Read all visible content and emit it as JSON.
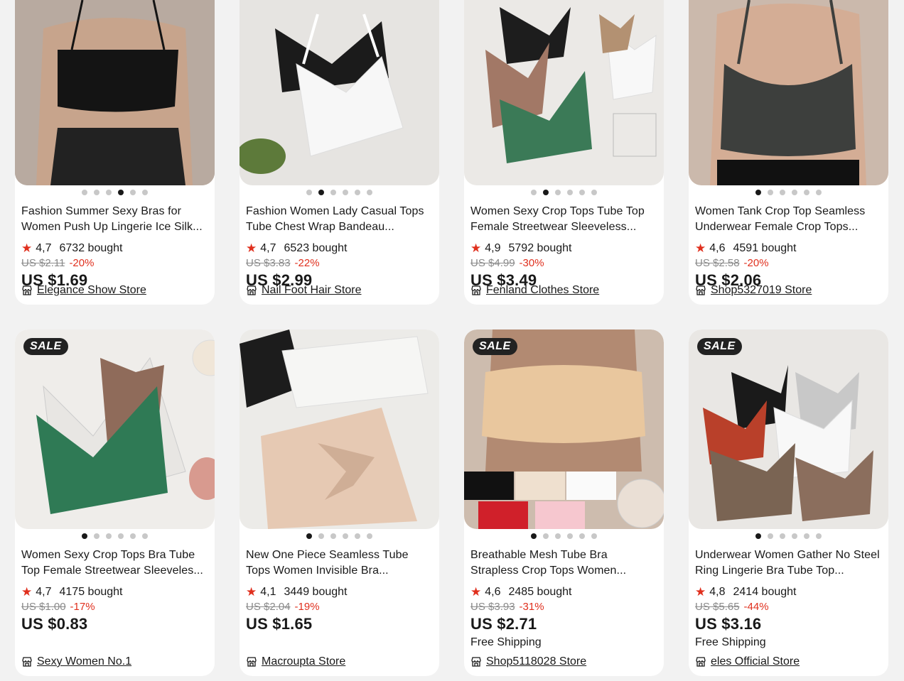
{
  "colors": {
    "accent_red": "#e0301e",
    "bg": "#f2f2f2",
    "card": "#ffffff"
  },
  "products": [
    {
      "title": "Fashion Summer Sexy Bras for Women Push Up Lingerie Ice Silk...",
      "rating": "4,7",
      "sold": "6732 bought",
      "original_price": "US $2.11",
      "discount": "-20%",
      "price": "US $1.69",
      "store": "Elegance Show Store",
      "sale_badge": "",
      "shipping": "",
      "active_dot": 3
    },
    {
      "title": "Fashion Women Lady Casual Tops Tube Chest Wrap Bandeau...",
      "rating": "4,7",
      "sold": "6523 bought",
      "original_price": "US $3.83",
      "discount": "-22%",
      "price": "US $2.99",
      "store": "Nail Foot Hair Store",
      "sale_badge": "",
      "shipping": "",
      "active_dot": 1
    },
    {
      "title": "Women Sexy Crop Tops Tube Top Female Streetwear Sleeveless...",
      "rating": "4,9",
      "sold": "5792 bought",
      "original_price": "US $4.99",
      "discount": "-30%",
      "price": "US $3.49",
      "store": "Fenland Clothes Store",
      "sale_badge": "",
      "shipping": "",
      "active_dot": 1
    },
    {
      "title": "Women Tank Crop Top Seamless Underwear Female Crop Tops...",
      "rating": "4,6",
      "sold": "4591 bought",
      "original_price": "US $2.58",
      "discount": "-20%",
      "price": "US $2.06",
      "store": "Shop5327019 Store",
      "sale_badge": "",
      "shipping": "",
      "active_dot": 0
    },
    {
      "title": "Women Sexy Crop Tops Bra Tube Top Female Streetwear Sleeveles...",
      "rating": "4,7",
      "sold": "4175 bought",
      "original_price": "US $1.00",
      "discount": "-17%",
      "price": "US $0.83",
      "store": "Sexy Women No.1",
      "sale_badge": "SALE",
      "shipping": "",
      "active_dot": 0
    },
    {
      "title": "New One Piece Seamless Tube Tops Women Invisible Bra...",
      "rating": "4,1",
      "sold": "3449 bought",
      "original_price": "US $2.04",
      "discount": "-19%",
      "price": "US $1.65",
      "store": "Macroupta Store",
      "sale_badge": "",
      "shipping": "",
      "active_dot": 0
    },
    {
      "title": "Breathable Mesh Tube Bra Strapless Crop Tops Women...",
      "rating": "4,6",
      "sold": "2485 bought",
      "original_price": "US $3.93",
      "discount": "-31%",
      "price": "US $2.71",
      "store": "Shop5118028 Store",
      "sale_badge": "SALE",
      "shipping": "Free Shipping",
      "active_dot": 0
    },
    {
      "title": "Underwear Women Gather No Steel Ring Lingerie Bra Tube Top...",
      "rating": "4,8",
      "sold": "2414 bought",
      "original_price": "US $5.65",
      "discount": "-44%",
      "price": "US $3.16",
      "store": "eles Official Store",
      "sale_badge": "SALE",
      "shipping": "Free Shipping",
      "active_dot": 0
    }
  ],
  "icons": {
    "rating": "star-icon",
    "store": "store-icon"
  },
  "star_glyph": "★"
}
